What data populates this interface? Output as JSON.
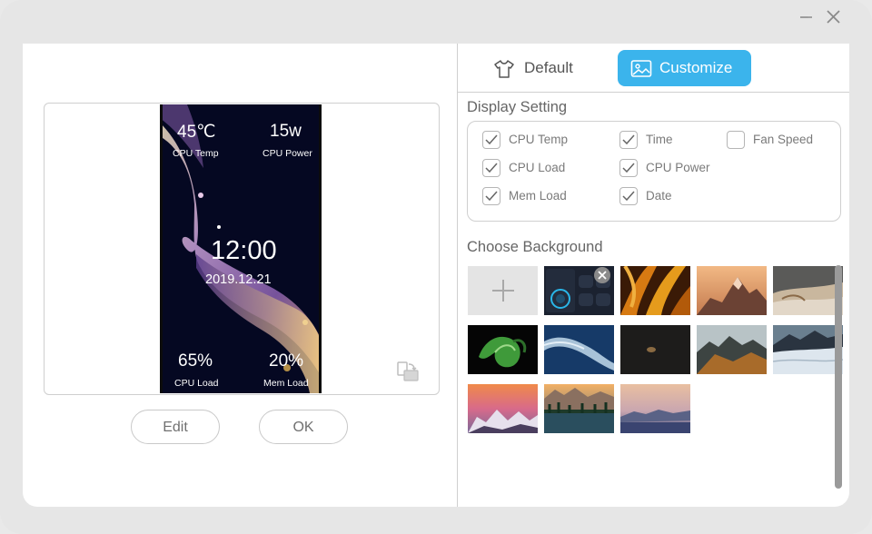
{
  "window": {
    "controls": {
      "minimize": "minimize",
      "close": "close"
    }
  },
  "preview": {
    "cpu_temp_value": "45℃",
    "cpu_temp_label": "CPU Temp",
    "cpu_power_value": "15w",
    "cpu_power_label": "CPU Power",
    "time": "12:00",
    "date": "2019.12.21",
    "cpu_load_value": "65%",
    "cpu_load_label": "CPU Load",
    "mem_load_value": "20%",
    "mem_load_label": "Mem Load"
  },
  "actions": {
    "edit_label": "Edit",
    "ok_label": "OK"
  },
  "tabs": [
    {
      "label": "Default",
      "icon": "tshirt-icon",
      "active": false
    },
    {
      "label": "Customize",
      "icon": "image-icon",
      "active": true
    }
  ],
  "display_setting": {
    "title": "Display Setting",
    "options": [
      {
        "label": "CPU Temp",
        "checked": true
      },
      {
        "label": "Time",
        "checked": true
      },
      {
        "label": "Fan Speed",
        "checked": false
      },
      {
        "label": "CPU Load",
        "checked": true
      },
      {
        "label": "CPU Power",
        "checked": true
      },
      {
        "label": "Mem Load",
        "checked": true
      },
      {
        "label": "Date",
        "checked": true
      }
    ]
  },
  "background": {
    "title": "Choose Background",
    "add_icon": "plus-icon",
    "thumbnails": [
      "device-theme",
      "orange-petals",
      "mountain-sunset",
      "desert-hills",
      "green-leaf",
      "aerial-coast",
      "dark-object",
      "mountain-ridge",
      "snowy-mountain",
      "pink-sunset-peaks",
      "lake-forest",
      "dusk-mountains"
    ]
  },
  "colors": {
    "accent": "#3bb4ec",
    "window_bg": "#e6e6e6",
    "panel_bg": "#ffffff"
  }
}
